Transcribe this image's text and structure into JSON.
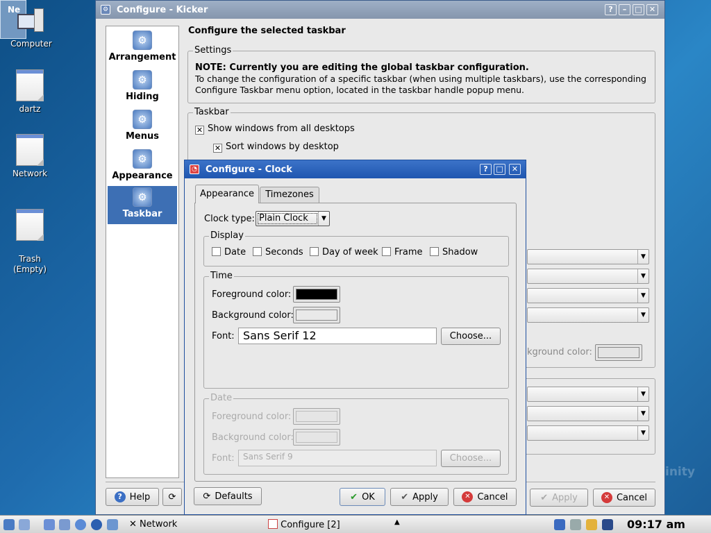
{
  "desktop": {
    "corner_label": "Ne",
    "icons": [
      {
        "label": "Computer"
      },
      {
        "label": "dartz"
      },
      {
        "label": "Network"
      },
      {
        "label": "Trash\n(Empty)"
      }
    ],
    "watermark": "inity"
  },
  "kicker": {
    "title": "Configure - Kicker",
    "heading": "Configure the selected taskbar",
    "nav": [
      "Arrangement",
      "Hiding",
      "Menus",
      "Appearance",
      "Taskbar"
    ],
    "settings": {
      "label": "Settings",
      "note": "NOTE: Currently you are editing the global taskbar configuration.",
      "text1": "To change the configuration of a specific taskbar (when using multiple taskbars), use the corresponding",
      "text2": "Configure Taskbar menu option, located in the taskbar handle popup menu."
    },
    "taskbar_group": {
      "label": "Taskbar",
      "show_all": "Show windows from all desktops",
      "sort_desktop": "Sort windows by desktop"
    },
    "bg_color_partial": "kground color:",
    "buttons": {
      "help": "Help",
      "apply": "Apply",
      "cancel": "Cancel"
    }
  },
  "clock": {
    "title": "Configure - Clock",
    "tabs": [
      "Appearance",
      "Timezones"
    ],
    "clock_type_label": "Clock type:",
    "clock_type_value": "Plain Clock",
    "display": {
      "label": "Display",
      "options": [
        "Date",
        "Seconds",
        "Day of week",
        "Frame",
        "Shadow"
      ]
    },
    "time": {
      "label": "Time",
      "fg_label": "Foreground color:",
      "bg_label": "Background color:",
      "font_label": "Font:",
      "font_value": "Sans Serif 12",
      "choose": "Choose..."
    },
    "date": {
      "label": "Date",
      "fg_label": "Foreground color:",
      "bg_label": "Background color:",
      "font_label": "Font:",
      "font_value": "Sans Serif 9",
      "choose": "Choose..."
    },
    "buttons": {
      "defaults": "Defaults",
      "ok": "OK",
      "apply": "Apply",
      "cancel": "Cancel"
    }
  },
  "taskbar": {
    "network": "Network",
    "configure": "Configure [2]",
    "time": "09:17 am"
  },
  "colors": {
    "accent": "#3d6fb4",
    "clock_titlebar": "#2a62bd"
  }
}
